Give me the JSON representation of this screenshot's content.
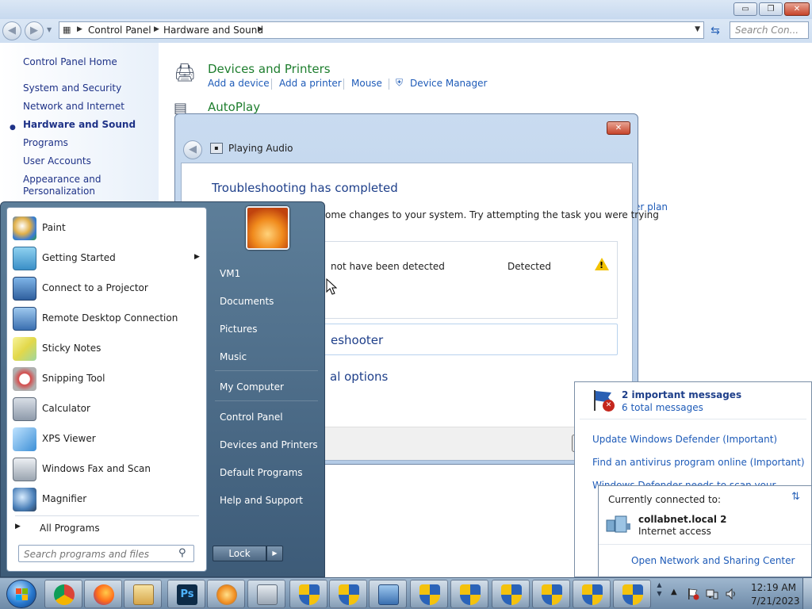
{
  "window": {
    "minimize_label": "▭",
    "maximize_label": "❐",
    "close_label": "✕"
  },
  "nav": {
    "breadcrumbs": [
      "Control Panel",
      "Hardware and Sound"
    ],
    "search_placeholder": "Search Con..."
  },
  "sidebar": {
    "home": "Control Panel Home",
    "items": [
      {
        "label": "System and Security",
        "active": false
      },
      {
        "label": "Network and Internet",
        "active": false
      },
      {
        "label": "Hardware and Sound",
        "active": true
      },
      {
        "label": "Programs",
        "active": false
      },
      {
        "label": "User Accounts",
        "active": false
      },
      {
        "label": "Appearance and",
        "active": false
      },
      {
        "label": "Personalization",
        "active": false
      }
    ]
  },
  "main": {
    "devices_title": "Devices and Printers",
    "devices_links": [
      "Add a device",
      "Add a printer",
      "Mouse",
      "Device Manager"
    ],
    "autoplay_title": "AutoPlay",
    "power_plan_fragment": "er plan"
  },
  "dialog": {
    "window_title": "Playing Audio",
    "heading": "Troubleshooting has completed",
    "description": "ome changes to your system. Try attempting the task you were trying",
    "issue": "not have been detected",
    "issue_status": "Detected",
    "close_fragment": "eshooter",
    "explore_fragment": "al options"
  },
  "start_menu": {
    "programs": [
      {
        "label": "Paint",
        "icon": "paint-icon",
        "has_submenu": false
      },
      {
        "label": "Getting Started",
        "icon": "getting-started-icon",
        "has_submenu": true
      },
      {
        "label": "Connect to a Projector",
        "icon": "projector-icon",
        "has_submenu": false
      },
      {
        "label": "Remote Desktop Connection",
        "icon": "remote-desktop-icon",
        "has_submenu": false
      },
      {
        "label": "Sticky Notes",
        "icon": "sticky-notes-icon",
        "has_submenu": false
      },
      {
        "label": "Snipping Tool",
        "icon": "snipping-tool-icon",
        "has_submenu": false
      },
      {
        "label": "Calculator",
        "icon": "calculator-icon",
        "has_submenu": false
      },
      {
        "label": "XPS Viewer",
        "icon": "xps-viewer-icon",
        "has_submenu": false
      },
      {
        "label": "Windows Fax and Scan",
        "icon": "fax-scan-icon",
        "has_submenu": false
      },
      {
        "label": "Magnifier",
        "icon": "magnifier-icon",
        "has_submenu": false
      }
    ],
    "all_programs": "All Programs",
    "search_placeholder": "Search programs and files",
    "right_items": [
      "VM1",
      "Documents",
      "Pictures",
      "Music",
      "My Computer",
      "Control Panel",
      "Devices and Printers",
      "Default Programs",
      "Help and Support"
    ],
    "lock_label": "Lock"
  },
  "action_center": {
    "important": "2 important messages",
    "total": "6 total messages",
    "messages": [
      "Update Windows Defender (Important)",
      "Find an antivirus program online (Important)",
      "Windows Defender needs to scan your"
    ]
  },
  "network": {
    "header": "Currently connected to:",
    "name": "collabnet.local  2",
    "status": "Internet access",
    "link": "Open Network and Sharing Center"
  },
  "taskbar": {
    "apps": [
      "chrome-icon",
      "firefox-icon",
      "explorer-icon",
      "photoshop-icon",
      "media-player-icon",
      "calculator-icon",
      "security-shield-icon",
      "security-shield-icon",
      "remote-desktop-icon",
      "security-shield-icon",
      "security-shield-icon",
      "security-shield-icon",
      "security-shield-icon",
      "security-shield-icon",
      "security-shield-icon"
    ],
    "time": "12:19 AM",
    "date": "7/21/2023"
  }
}
